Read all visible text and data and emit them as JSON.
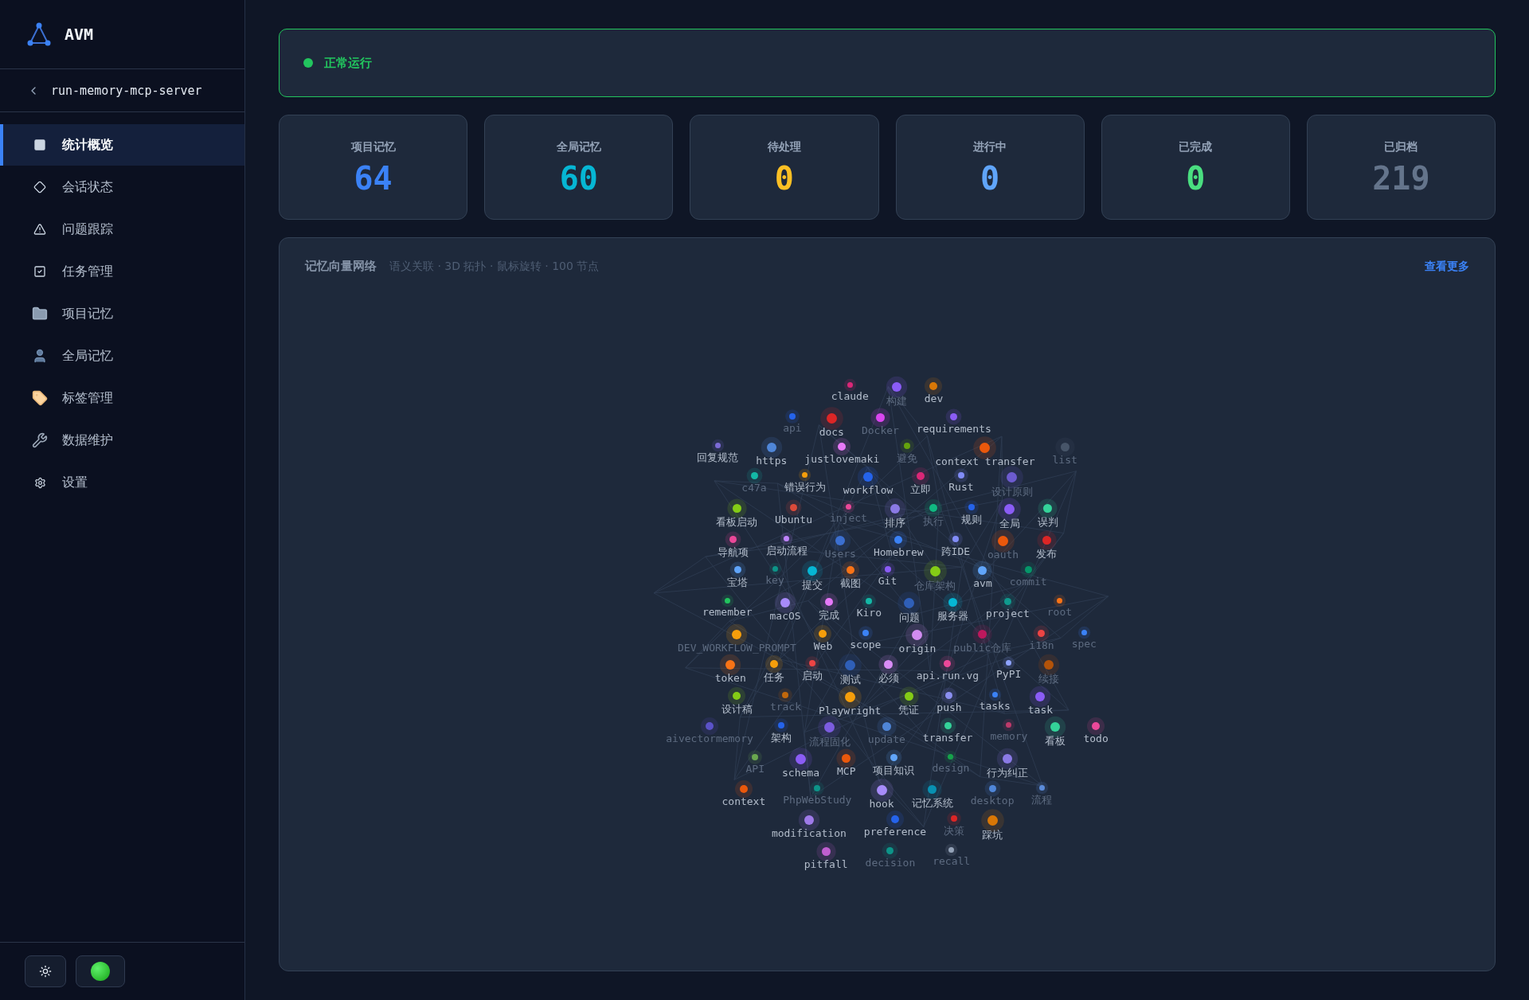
{
  "brand": {
    "name": "AVM"
  },
  "project": {
    "name": "run-memory-mcp-server"
  },
  "nav": [
    {
      "label": "统计概览",
      "selected": true
    },
    {
      "label": "会话状态",
      "selected": false
    },
    {
      "label": "问题跟踪",
      "selected": false
    },
    {
      "label": "任务管理",
      "selected": false
    },
    {
      "label": "项目记忆",
      "selected": false
    },
    {
      "label": "全局记忆",
      "selected": false
    },
    {
      "label": "标签管理",
      "selected": false
    },
    {
      "label": "数据维护",
      "selected": false
    },
    {
      "label": "设置",
      "selected": false
    }
  ],
  "status": {
    "label": "正常运行",
    "color": "#22c55e"
  },
  "stats": [
    {
      "label": "项目记忆",
      "value": "64",
      "color": "#3b82f6"
    },
    {
      "label": "全局记忆",
      "value": "60",
      "color": "#06b6d4"
    },
    {
      "label": "待处理",
      "value": "0",
      "color": "#fbbf24"
    },
    {
      "label": "进行中",
      "value": "0",
      "color": "#60a5fa"
    },
    {
      "label": "已完成",
      "value": "0",
      "color": "#4ade80"
    },
    {
      "label": "已归档",
      "value": "219",
      "color": "#64748b"
    }
  ],
  "network": {
    "title": "记忆向量网络",
    "subtitle": "语义关联 · 3D 拓扑 · 鼠标旋转 · 100 节点",
    "more": "查看更多",
    "nodes": [
      {
        "label": "claude",
        "color": "#db2777",
        "faded": false
      },
      {
        "label": "构建",
        "color": "#8b5cf6",
        "faded": true
      },
      {
        "label": "dev",
        "color": "#d97706",
        "faded": false
      },
      {
        "label": "api",
        "color": "#2563eb",
        "faded": true
      },
      {
        "label": "docs",
        "color": "#dc2626",
        "faded": false
      },
      {
        "label": "Docker",
        "color": "#d946ef",
        "faded": true
      },
      {
        "label": "requirements",
        "color": "#8b5cf6",
        "faded": false
      },
      {
        "label": "回复规范",
        "color": "#7c6bd6",
        "faded": false
      },
      {
        "label": "https",
        "color": "#4f86d8",
        "faded": false
      },
      {
        "label": "justlovemaki",
        "color": "#e879f9",
        "faded": false
      },
      {
        "label": "避免",
        "color": "#65a30d",
        "faded": true
      },
      {
        "label": "context transfer",
        "color": "#ea580c",
        "faded": false
      },
      {
        "label": "list",
        "color": "#475569",
        "faded": true
      },
      {
        "label": "c47a",
        "color": "#14b8a6",
        "faded": true
      },
      {
        "label": "错误行为",
        "color": "#f59e0b",
        "faded": false
      },
      {
        "label": "workflow",
        "color": "#2563eb",
        "faded": false
      },
      {
        "label": "立即",
        "color": "#db2777",
        "faded": false
      },
      {
        "label": "Rust",
        "color": "#818cf8",
        "faded": false
      },
      {
        "label": "设计原则",
        "color": "#6d5bd0",
        "faded": true
      },
      {
        "label": "看板启动",
        "color": "#84cc16",
        "faded": false
      },
      {
        "label": "Ubuntu",
        "color": "#dc4a3a",
        "faded": false
      },
      {
        "label": "inject",
        "color": "#ec4899",
        "faded": true
      },
      {
        "label": "排序",
        "color": "#8b7ae6",
        "faded": false
      },
      {
        "label": "执行",
        "color": "#10b981",
        "faded": true
      },
      {
        "label": "规则",
        "color": "#2563eb",
        "faded": false
      },
      {
        "label": "全局",
        "color": "#8b5cf6",
        "faded": false
      },
      {
        "label": "误判",
        "color": "#34d399",
        "faded": false
      },
      {
        "label": "导航项",
        "color": "#ec4899",
        "faded": false
      },
      {
        "label": "启动流程",
        "color": "#c084fc",
        "faded": false
      },
      {
        "label": "Users",
        "color": "#3b6fd1",
        "faded": true
      },
      {
        "label": "Homebrew",
        "color": "#3b82f6",
        "faded": false
      },
      {
        "label": "跨IDE",
        "color": "#818cf8",
        "faded": false
      },
      {
        "label": "oauth",
        "color": "#ea580c",
        "faded": true
      },
      {
        "label": "发布",
        "color": "#dc2626",
        "faded": false
      },
      {
        "label": "宝塔",
        "color": "#60a5fa",
        "faded": false
      },
      {
        "label": "key",
        "color": "#0d9488",
        "faded": true
      },
      {
        "label": "提交",
        "color": "#06b6d4",
        "faded": false
      },
      {
        "label": "截图",
        "color": "#f97316",
        "faded": false
      },
      {
        "label": "Git",
        "color": "#8b5cf6",
        "faded": false
      },
      {
        "label": "仓库架构",
        "color": "#84cc16",
        "faded": true
      },
      {
        "label": "avm",
        "color": "#60a5fa",
        "faded": false
      },
      {
        "label": "commit",
        "color": "#059669",
        "faded": true
      },
      {
        "label": "remember",
        "color": "#22c55e",
        "faded": false
      },
      {
        "label": "macOS",
        "color": "#a78bfa",
        "faded": false
      },
      {
        "label": "完成",
        "color": "#e879f9",
        "faded": false
      },
      {
        "label": "Kiro",
        "color": "#14b8a6",
        "faded": false
      },
      {
        "label": "问题",
        "color": "#2f5fb8",
        "faded": false
      },
      {
        "label": "服务器",
        "color": "#06b6d4",
        "faded": false
      },
      {
        "label": "project",
        "color": "#0f9b8e",
        "faded": false
      },
      {
        "label": "root",
        "color": "#f97316",
        "faded": true
      },
      {
        "label": "DEV_WORKFLOW_PROMPT",
        "color": "#f59e0b",
        "faded": true
      },
      {
        "label": "Web",
        "color": "#f59e0b",
        "faded": false
      },
      {
        "label": "scope",
        "color": "#3b82f6",
        "faded": false
      },
      {
        "label": "origin",
        "color": "#d18cf0",
        "faded": false
      },
      {
        "label": "public仓库",
        "color": "#be185d",
        "faded": true
      },
      {
        "label": "i18n",
        "color": "#ef4444",
        "faded": true
      },
      {
        "label": "spec",
        "color": "#3b82f6",
        "faded": true
      },
      {
        "label": "token",
        "color": "#f97316",
        "faded": false
      },
      {
        "label": "任务",
        "color": "#f59e0b",
        "faded": false
      },
      {
        "label": "启动",
        "color": "#ef4444",
        "faded": false
      },
      {
        "label": "测试",
        "color": "#2f5fb8",
        "faded": false
      },
      {
        "label": "必须",
        "color": "#d88cf5",
        "faded": false
      },
      {
        "label": "api.run.vg",
        "color": "#ec4899",
        "faded": false
      },
      {
        "label": "PyPI",
        "color": "#8ea3ff",
        "faded": false
      },
      {
        "label": "续接",
        "color": "#b45309",
        "faded": true
      },
      {
        "label": "设计稿",
        "color": "#84cc16",
        "faded": false
      },
      {
        "label": "track",
        "color": "#c2680c",
        "faded": true
      },
      {
        "label": "Playwright",
        "color": "#f59e0b",
        "faded": false
      },
      {
        "label": "凭证",
        "color": "#84cc16",
        "faded": false
      },
      {
        "label": "push",
        "color": "#8b8ff0",
        "faded": false
      },
      {
        "label": "tasks",
        "color": "#3b82f6",
        "faded": false
      },
      {
        "label": "task",
        "color": "#8b5cf6",
        "faded": false
      },
      {
        "label": "aivectormemory",
        "color": "#5b52c8",
        "faded": true
      },
      {
        "label": "架构",
        "color": "#2563eb",
        "faded": false
      },
      {
        "label": "流程固化",
        "color": "#7c5ce0",
        "faded": true
      },
      {
        "label": "update",
        "color": "#4f86d8",
        "faded": true
      },
      {
        "label": "transfer",
        "color": "#34d399",
        "faded": false
      },
      {
        "label": "memory",
        "color": "#be3a6a",
        "faded": true
      },
      {
        "label": "看板",
        "color": "#34d399",
        "faded": false
      },
      {
        "label": "todo",
        "color": "#ec4899",
        "faded": false
      },
      {
        "label": "API",
        "color": "#6aa84f",
        "faded": true
      },
      {
        "label": "schema",
        "color": "#8b5cf6",
        "faded": false
      },
      {
        "label": "MCP",
        "color": "#ea580c",
        "faded": false
      },
      {
        "label": "项目知识",
        "color": "#60a5fa",
        "faded": false
      },
      {
        "label": "design",
        "color": "#16a34a",
        "faded": true
      },
      {
        "label": "行为纠正",
        "color": "#8b7ae6",
        "faded": false
      },
      {
        "label": "context",
        "color": "#ea580c",
        "faded": false
      },
      {
        "label": "PhpWebStudy",
        "color": "#0d9488",
        "faded": true
      },
      {
        "label": "hook",
        "color": "#a78bfa",
        "faded": false
      },
      {
        "label": "记忆系统",
        "color": "#0891b2",
        "faded": false
      },
      {
        "label": "desktop",
        "color": "#4f86d8",
        "faded": true
      },
      {
        "label": "流程",
        "color": "#5b8bd8",
        "faded": true
      },
      {
        "label": "modification",
        "color": "#9f7aea",
        "faded": false
      },
      {
        "label": "preference",
        "color": "#2563eb",
        "faded": false
      },
      {
        "label": "决策",
        "color": "#dc2626",
        "faded": true
      },
      {
        "label": "踩坑",
        "color": "#d97706",
        "faded": false
      },
      {
        "label": "pitfall",
        "color": "#c05fd0",
        "faded": false
      },
      {
        "label": "decision",
        "color": "#0d9488",
        "faded": true
      },
      {
        "label": "recall",
        "color": "#94a3b8",
        "faded": true
      }
    ]
  }
}
